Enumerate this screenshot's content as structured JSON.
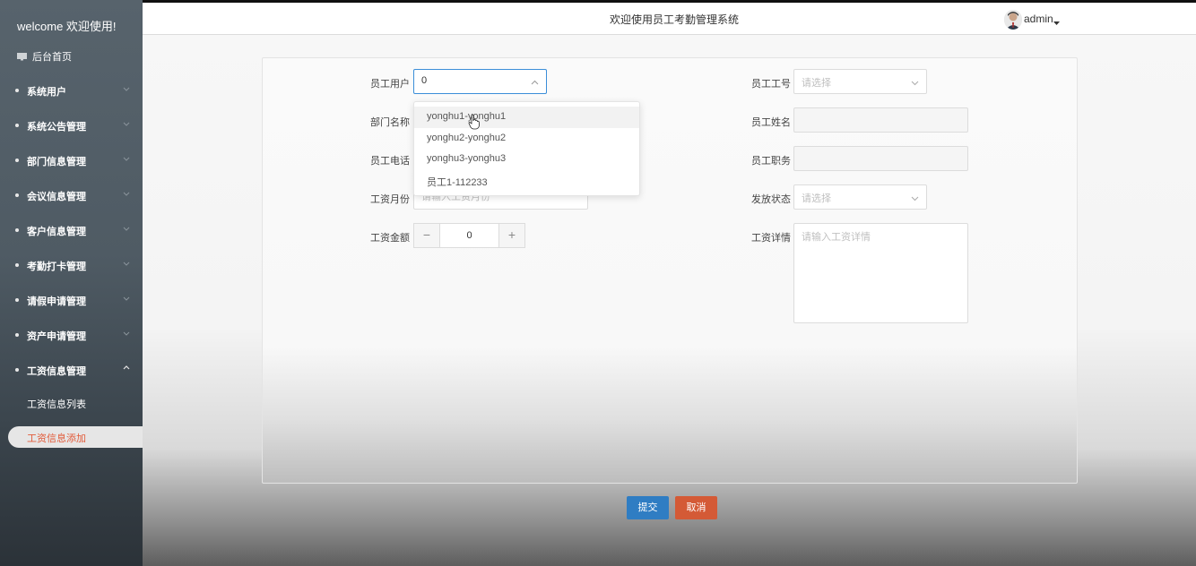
{
  "sidebar": {
    "welcome": "welcome 欢迎使用!",
    "home": "后台首页",
    "items": [
      {
        "label": "系统用户"
      },
      {
        "label": "系统公告管理"
      },
      {
        "label": "部门信息管理"
      },
      {
        "label": "会议信息管理"
      },
      {
        "label": "客户信息管理"
      },
      {
        "label": "考勤打卡管理"
      },
      {
        "label": "请假申请管理"
      },
      {
        "label": "资产申请管理"
      },
      {
        "label": "工资信息管理"
      }
    ],
    "sub_items": [
      {
        "label": "工资信息列表"
      },
      {
        "label": "工资信息添加"
      }
    ]
  },
  "header": {
    "title": "欢迎使用员工考勤管理系统",
    "user": "admin"
  },
  "form": {
    "employee_user": {
      "label": "员工用户",
      "value": "0"
    },
    "department": {
      "label": "部门名称"
    },
    "phone": {
      "label": "员工电话"
    },
    "salary_month": {
      "label": "工资月份",
      "placeholder": "请输入工资月份"
    },
    "salary_amount": {
      "label": "工资金额",
      "value": "0"
    },
    "employee_no": {
      "label": "员工工号",
      "placeholder": "请选择"
    },
    "employee_name": {
      "label": "员工姓名"
    },
    "position": {
      "label": "员工职务"
    },
    "status": {
      "label": "发放状态",
      "placeholder": "请选择"
    },
    "details": {
      "label": "工资详情",
      "placeholder": "请输入工资详情"
    }
  },
  "dropdown": {
    "options": [
      {
        "label": "yonghu1-yonghu1"
      },
      {
        "label": "yonghu2-yonghu2"
      },
      {
        "label": "yonghu3-yonghu3"
      },
      {
        "label": "员工1-112233"
      }
    ]
  },
  "buttons": {
    "submit": "提交",
    "cancel": "取消"
  },
  "colors": {
    "primary": "#2f7dc3",
    "danger": "#d45a36",
    "active_menu_text": "#e25b3a",
    "sidebar_bg": "#4f5b64"
  }
}
